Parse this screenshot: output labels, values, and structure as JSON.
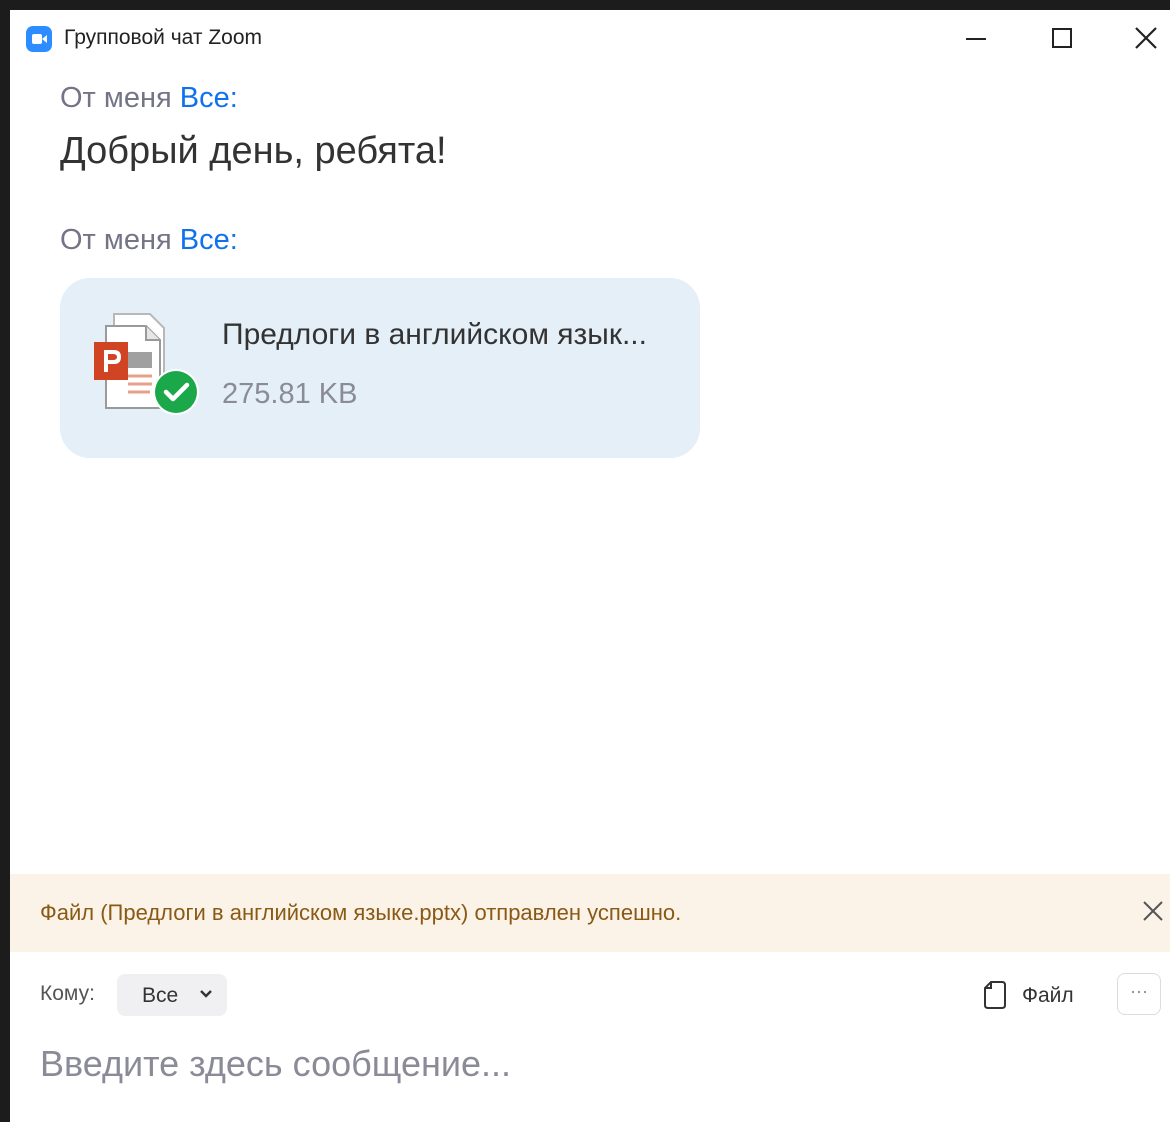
{
  "window": {
    "title": "Групповой чат Zoom"
  },
  "messages": [
    {
      "sender_from": "От меня",
      "sender_to": "Все:",
      "text": "Добрый день, ребята!"
    },
    {
      "sender_from": "От меня",
      "sender_to": "Все:",
      "file": {
        "name": "Предлоги в английском язык...",
        "size": "275.81 KB",
        "type_icon": "powerpoint-file-icon",
        "status_icon": "check-circle-icon"
      }
    }
  ],
  "banner": {
    "text": "Файл (Предлоги в английском языке.pptx) отправлен успешно."
  },
  "composer": {
    "to_label": "Кому:",
    "to_value": "Все",
    "file_label": "Файл",
    "more_label": "···",
    "placeholder": "Введите здесь сообщение..."
  },
  "colors": {
    "accent": "#0e72ed",
    "file_card_bg": "#e5eff7",
    "banner_bg": "#fbf3e8",
    "success": "#1aa84a",
    "ppt_red": "#d04423"
  }
}
